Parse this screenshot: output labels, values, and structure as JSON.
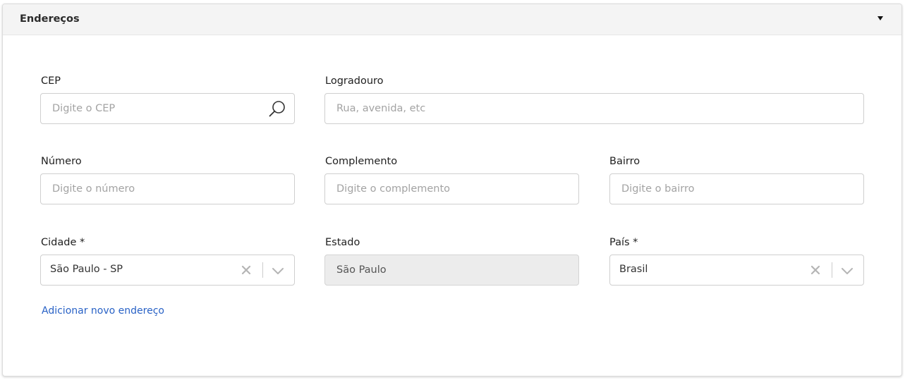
{
  "section": {
    "title": "Endereços",
    "toggle_icon": "caret-down-icon"
  },
  "fields": {
    "cep": {
      "label": "CEP",
      "placeholder": "Digite o CEP",
      "icon": "search-icon"
    },
    "logradouro": {
      "label": "Logradouro",
      "placeholder": "Rua, avenida, etc"
    },
    "numero": {
      "label": "Número",
      "placeholder": "Digite o número"
    },
    "complemento": {
      "label": "Complemento",
      "placeholder": "Digite o complemento"
    },
    "bairro": {
      "label": "Bairro",
      "placeholder": "Digite o bairro"
    },
    "cidade": {
      "label": "Cidade *",
      "value": "São Paulo - SP"
    },
    "estado": {
      "label": "Estado",
      "value": "São Paulo"
    },
    "pais": {
      "label": "País *",
      "value": "Brasil"
    }
  },
  "actions": {
    "add_address": "Adicionar novo endereço"
  },
  "colors": {
    "link": "#2962c6",
    "header_bg": "#f4f4f4",
    "disabled_bg": "#ececec"
  }
}
